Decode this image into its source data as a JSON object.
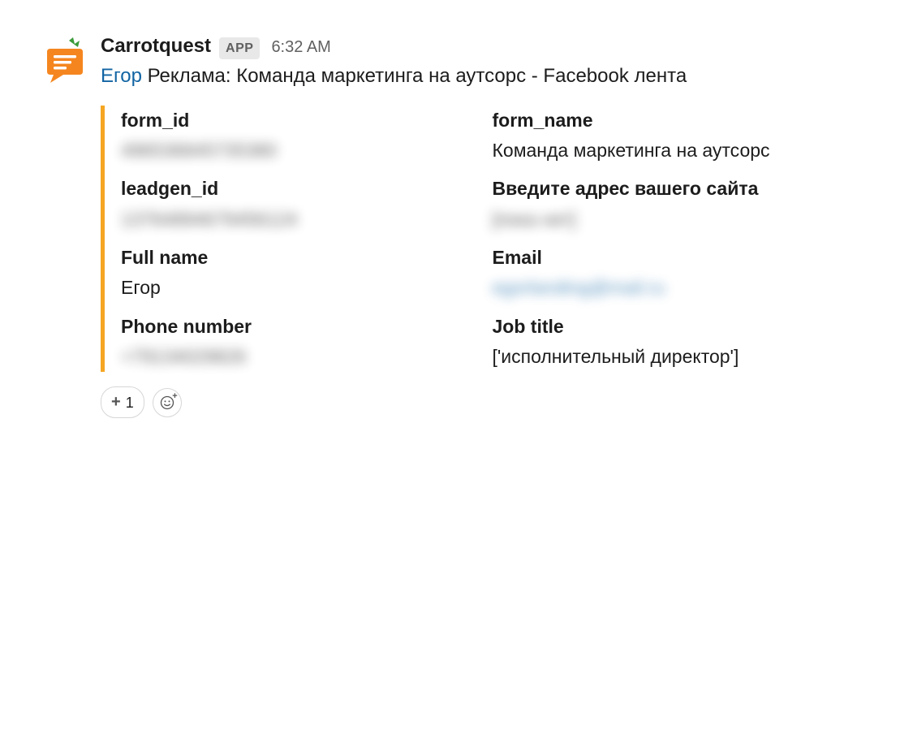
{
  "message": {
    "sender": "Carrotquest",
    "badge": "APP",
    "timestamp": "6:32 AM",
    "link_text": "Егор",
    "text_rest": " Реклама: Команда маркетинга на аутсорс - Facebook лента"
  },
  "fields": {
    "form_id_label": "form_id",
    "form_id_value": "496536845735380",
    "form_name_label": "form_name",
    "form_name_value": "Команда маркетинга на аутсорс",
    "leadgen_id_label": "leadgen_id",
    "leadgen_id_value": "13764894679456124",
    "site_label": "Введите адрес вашего сайта",
    "site_value": "[пока нет]",
    "full_name_label": "Full name",
    "full_name_value": "Егор",
    "email_label": "Email",
    "email_value": "egorlanding@mail.ru",
    "phone_label": "Phone number",
    "phone_value": "+79134029826",
    "job_label": "Job title",
    "job_value": "['исполнительный директор']"
  },
  "reactions": {
    "count": "1"
  }
}
